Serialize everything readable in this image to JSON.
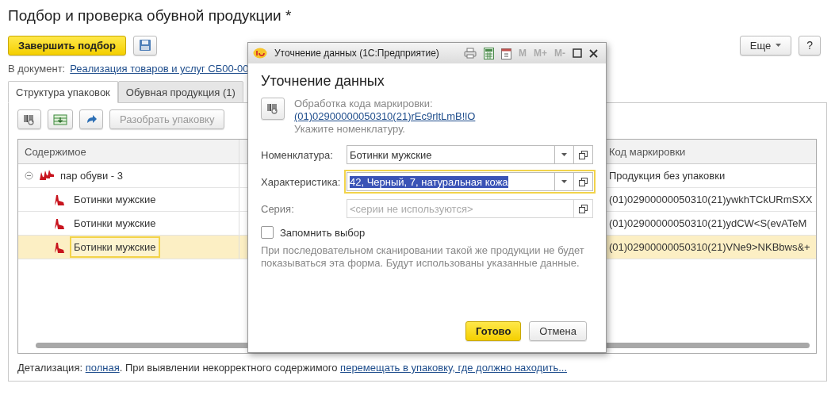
{
  "page": {
    "title": "Подбор и проверка обувной продукции *"
  },
  "toolbar": {
    "finish_button": "Завершить подбор",
    "more_button": "Еще",
    "help_button": "?"
  },
  "document": {
    "label": "В документ:",
    "link": "Реализация товаров и услуг СБ00-00"
  },
  "tabs": [
    {
      "label": "Структура упаковок",
      "selected": true
    },
    {
      "label": "Обувная продукция (1)",
      "selected": false
    }
  ],
  "table_toolbar": {
    "unpack_button": "Разобрать упаковку"
  },
  "table": {
    "columns": [
      "Содержимое",
      "Код маркировки"
    ],
    "rows": [
      {
        "content": "пар обуви - 3",
        "code": "Продукция без упаковки",
        "expanded": true,
        "selected": false,
        "children": [
          {
            "content": "Ботинки мужские",
            "code": "(01)02900000050310(21)ywkhTCkURmSXX",
            "selected": false
          },
          {
            "content": "Ботинки мужские",
            "code": "(01)02900000050310(21)ydCW<S(evATeM",
            "selected": false
          },
          {
            "content": "Ботинки мужские",
            "code": "(01)02900000050310(21)VNe9>NKBbws&+",
            "selected": true
          }
        ]
      }
    ]
  },
  "footer": {
    "label": "Детализация:",
    "detail_link": "полная",
    "text": ". При выявлении некорректного содержимого",
    "move_link": "перемещать в упаковку, где должно находить..."
  },
  "dialog": {
    "window_title": "Уточнение данных  (1С:Предприятие)",
    "title_buttons": [
      "M",
      "M+",
      "M-"
    ],
    "heading": "Уточнение данных",
    "info_label": "Обработка кода маркировки:",
    "code_link": "(01)02900000050310(21)rEc9rltLmB!lO",
    "hint": "Укажите номенклатуру.",
    "fields": [
      {
        "label": "Номенклатура:",
        "value": "Ботинки мужские",
        "focused": false,
        "disabled": false,
        "dropdown": true
      },
      {
        "label": "Характеристика:",
        "value": "42, Черный, 7, натуральная кожа",
        "focused": true,
        "disabled": false,
        "dropdown": true
      },
      {
        "label": "Серия:",
        "placeholder": "<серии не используются>",
        "focused": false,
        "disabled": true,
        "dropdown": false
      }
    ],
    "remember": {
      "label": "Запомнить выбор",
      "checked": false
    },
    "note": "При последовательном сканировании такой же продукции не будет показываться эта форма. Будут использованы указанные данные.",
    "ok_button": "Готово",
    "cancel_button": "Отмена"
  }
}
